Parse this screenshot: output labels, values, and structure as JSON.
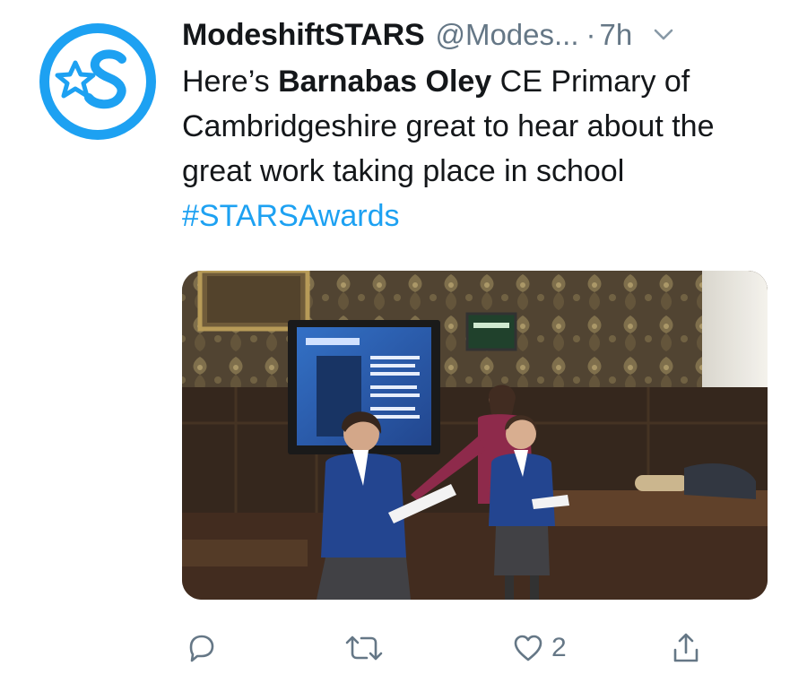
{
  "tweet": {
    "display_name": "ModeshiftSTARS",
    "handle": "@Modes...",
    "separator": "·",
    "time": "7h",
    "text": {
      "part1": "Here’s ",
      "bold": "Barnabas Oley",
      "part2": " CE Primary of Cambridgeshire great to hear about the great work taking place in school ",
      "hashtag": "#STARSAwards"
    },
    "media_icon": "photo",
    "colors": {
      "avatar_ring": "#1da1f2",
      "hashtag": "#1da1f2",
      "muted": "#657786"
    }
  },
  "actions": {
    "reply_icon": "reply-icon",
    "retweet_icon": "retweet-icon",
    "like_icon": "heart-icon",
    "like_count": "2",
    "share_icon": "share-icon"
  }
}
